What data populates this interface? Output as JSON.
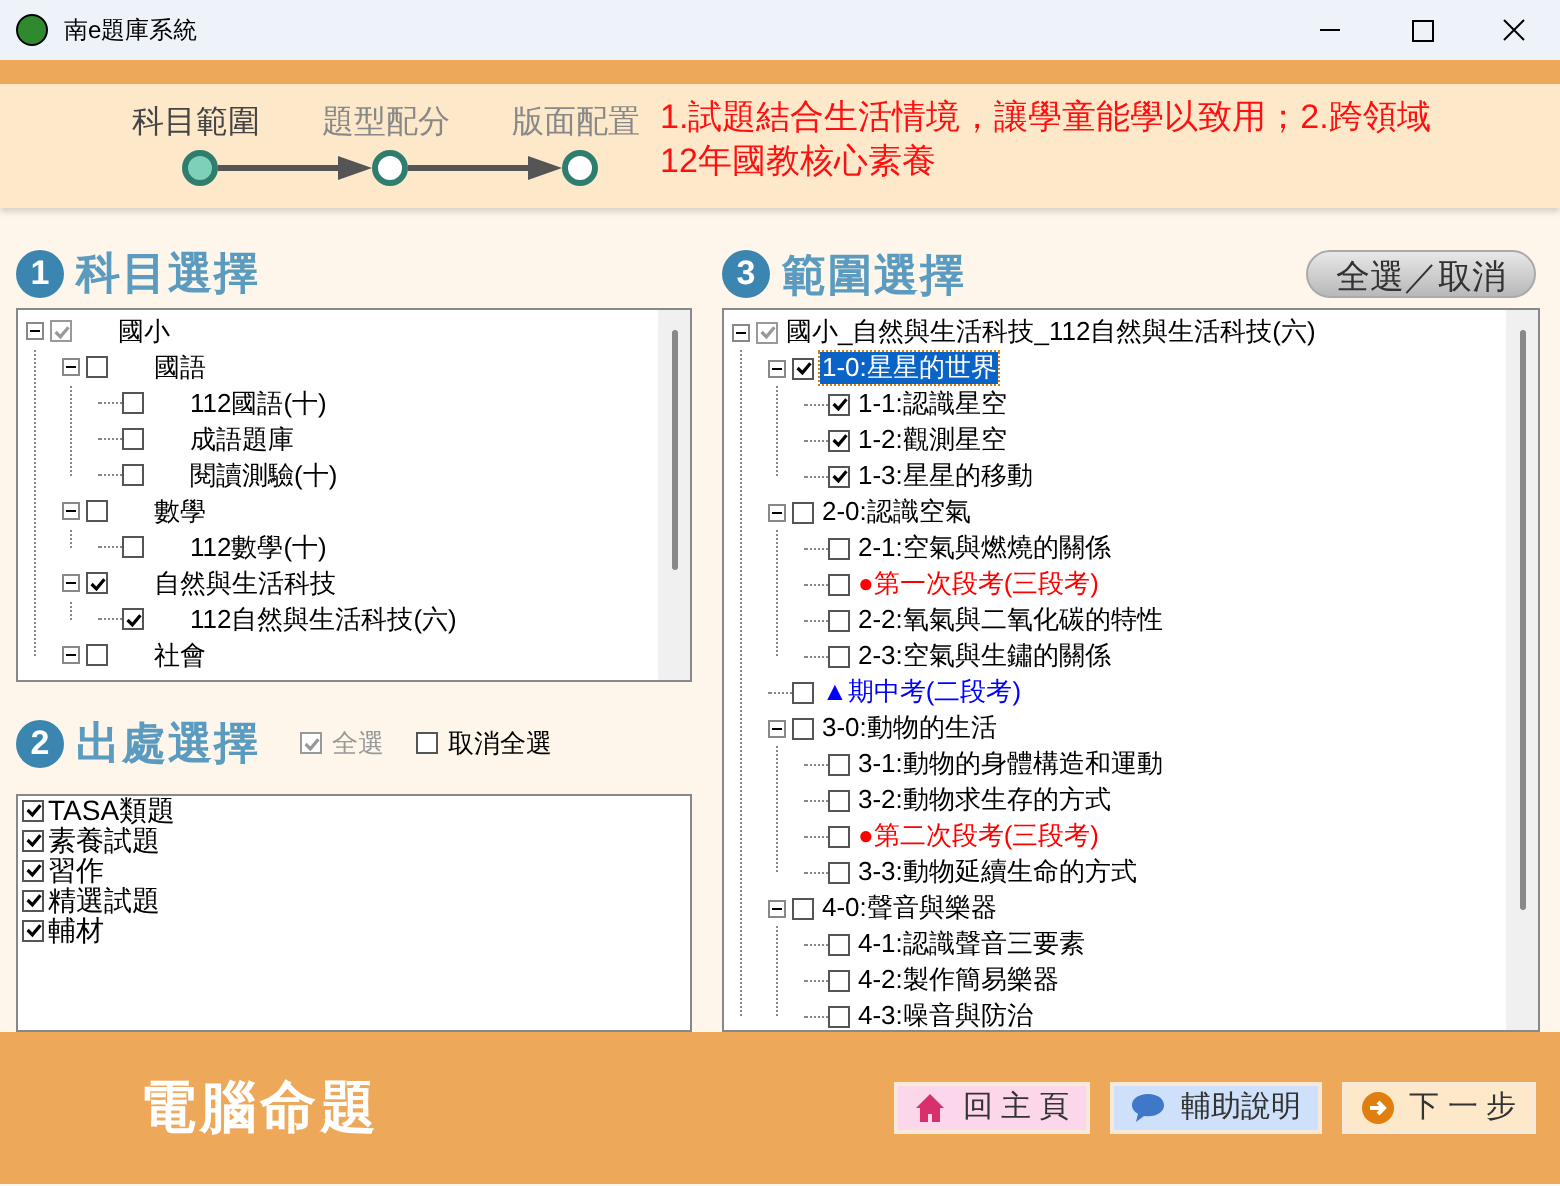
{
  "window": {
    "title": "南e題庫系統"
  },
  "steps": [
    {
      "label": "科目範圍",
      "selected": true
    },
    {
      "label": "題型配分",
      "selected": false
    },
    {
      "label": "版面配置",
      "selected": false
    }
  ],
  "notice": [
    "1.試題結合生活情境，讓學童能學以致用；2.跨領域",
    "12年國教核心素養"
  ],
  "subject_panel": {
    "number": "1",
    "title": "科目選擇",
    "tree": [
      {
        "label": "國小",
        "checked": true,
        "partial": true,
        "expanded": true,
        "children": [
          {
            "label": "國語",
            "checked": false,
            "expanded": true,
            "children": [
              {
                "label": "112國語(十)",
                "checked": false
              },
              {
                "label": "成語題庫",
                "checked": false
              },
              {
                "label": "閱讀測驗(十)",
                "checked": false
              }
            ]
          },
          {
            "label": "數學",
            "checked": false,
            "expanded": true,
            "children": [
              {
                "label": "112數學(十)",
                "checked": false
              }
            ]
          },
          {
            "label": "自然與生活科技",
            "checked": true,
            "expanded": true,
            "children": [
              {
                "label": "112自然與生活科技(六)",
                "checked": true
              }
            ]
          },
          {
            "label": "社會",
            "checked": false,
            "expanded": true
          }
        ]
      }
    ]
  },
  "source_panel": {
    "number": "2",
    "title": "出處選擇",
    "select_all": {
      "label": "全選",
      "checked": true,
      "disabled": true
    },
    "clear_all": {
      "label": "取消全選",
      "checked": false,
      "disabled": false
    },
    "items": [
      {
        "label": "TASA類題",
        "checked": true
      },
      {
        "label": "素養試題",
        "checked": true
      },
      {
        "label": "習作",
        "checked": true
      },
      {
        "label": "精選試題",
        "checked": true
      },
      {
        "label": "輔材",
        "checked": true
      }
    ]
  },
  "range_panel": {
    "number": "3",
    "title": "範圍選擇",
    "toggle_button": "全選／取消",
    "tree": [
      {
        "label": "國小_自然與生活科技_112自然與生活科技(六)",
        "checked": true,
        "partial": true,
        "expanded": true,
        "selected": false,
        "children": [
          {
            "label": "1-0:星星的世界",
            "checked": true,
            "expanded": true,
            "selected": true,
            "children": [
              {
                "label": "1-1:認識星空",
                "checked": true,
                "selected": false
              },
              {
                "label": "1-2:觀測星空",
                "checked": true,
                "selected": false
              },
              {
                "label": "1-3:星星的移動",
                "checked": true,
                "selected": false
              }
            ]
          },
          {
            "label": "2-0:認識空氣",
            "checked": false,
            "expanded": true,
            "selected": false,
            "children": [
              {
                "label": "2-1:空氣與燃燒的關係",
                "checked": false,
                "selected": false
              },
              {
                "label": "●第一次段考(三段考)",
                "checked": false,
                "selected": false,
                "color": "#ff0000"
              },
              {
                "label": "2-2:氧氣與二氧化碳的特性",
                "checked": false,
                "selected": false
              },
              {
                "label": "2-3:空氣與生鏽的關係",
                "checked": false,
                "selected": false
              }
            ]
          },
          {
            "label": "▲期中考(二段考)",
            "checked": false,
            "selected": false,
            "color": "#0000ff"
          },
          {
            "label": "3-0:動物的生活",
            "checked": false,
            "expanded": true,
            "selected": false,
            "children": [
              {
                "label": "3-1:動物的身體構造和運動",
                "checked": false,
                "selected": false
              },
              {
                "label": "3-2:動物求生存的方式",
                "checked": false,
                "selected": false
              },
              {
                "label": "●第二次段考(三段考)",
                "checked": false,
                "selected": false,
                "color": "#ff0000"
              },
              {
                "label": "3-3:動物延續生命的方式",
                "checked": false,
                "selected": false
              }
            ]
          },
          {
            "label": "4-0:聲音與樂器",
            "checked": false,
            "expanded": true,
            "selected": false,
            "children": [
              {
                "label": "4-1:認識聲音三要素",
                "checked": false,
                "selected": false
              },
              {
                "label": "4-2:製作簡易樂器",
                "checked": false,
                "selected": false
              },
              {
                "label": "4-3:噪音與防治",
                "checked": false,
                "selected": false
              }
            ]
          }
        ]
      }
    ]
  },
  "footer": {
    "title": "電腦命題",
    "buttons": [
      {
        "kind": "home",
        "label": "回 主 頁"
      },
      {
        "kind": "help",
        "label": "輔助說明"
      },
      {
        "kind": "next",
        "label": "下 一 步"
      }
    ]
  }
}
